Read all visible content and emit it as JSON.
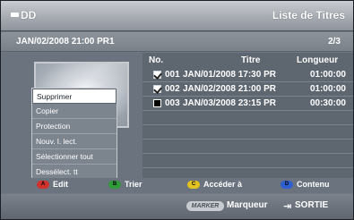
{
  "header": {
    "source_label": "DD",
    "title": "Liste de Titres"
  },
  "subheader": {
    "date": "JAN/02/2008 21:00 PR1",
    "page": "2/3"
  },
  "table": {
    "columns": {
      "no": "No.",
      "titre": "Titre",
      "longueur": "Longueur"
    },
    "rows": [
      {
        "checked": true,
        "num": "001",
        "title": "JAN/01/2008 17:30 PR",
        "duration": "01:00:00"
      },
      {
        "checked": true,
        "num": "002",
        "title": "JAN/02/2008 21:00 PR",
        "duration": "01:00:00"
      },
      {
        "checked": false,
        "num": "003",
        "title": "JAN/03/2008 23:15 PR",
        "duration": "00:30:00"
      }
    ]
  },
  "menu": {
    "items": [
      "Supprimer",
      "Copier",
      "Protection",
      "Nouv. l. lect.",
      "Sélectionner tout",
      "Dessélect. tt"
    ],
    "selected_index": 0
  },
  "legend": {
    "a": {
      "key": "A",
      "label": "Edit",
      "color": "#d0312d"
    },
    "b": {
      "key": "B",
      "label": "Trier",
      "color": "#2f9b3b"
    },
    "c": {
      "key": "C",
      "label": "Accéder à",
      "color": "#e2c21f"
    },
    "d": {
      "key": "D",
      "label": "Contenu",
      "color": "#2d5fd0"
    }
  },
  "footer": {
    "marker_button": "MARKER",
    "marker_label": "Marqueur",
    "exit_label": "SORTIE"
  }
}
